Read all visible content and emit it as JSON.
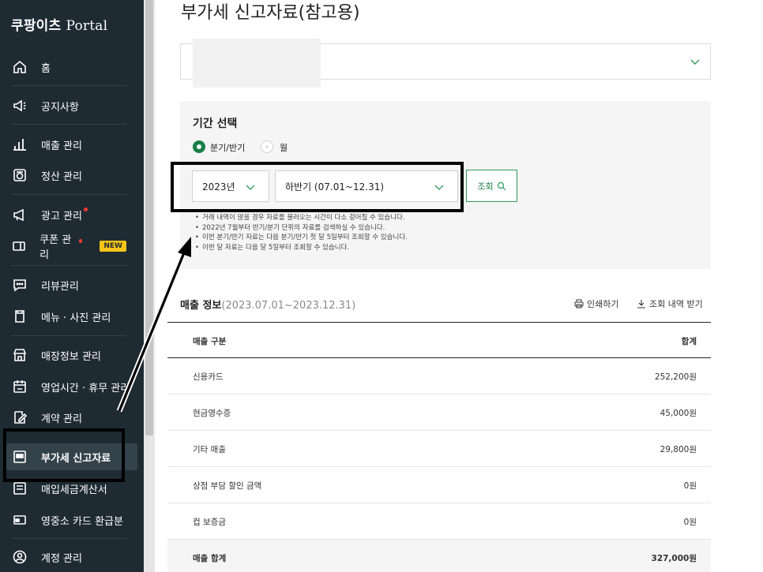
{
  "brand": {
    "ko": "쿠팡이츠",
    "en": "Portal"
  },
  "sidebar": {
    "items": [
      {
        "label": "홈",
        "icon": "home-icon"
      },
      {
        "label": "공지사항",
        "icon": "megaphone-icon"
      },
      {
        "label": "매출 관리",
        "icon": "bar-chart-icon"
      },
      {
        "label": "정산 관리",
        "icon": "settlement-icon"
      },
      {
        "label": "광고 관리",
        "icon": "ad-megaphone-icon"
      },
      {
        "label": "쿠폰 관리",
        "icon": "coupon-icon",
        "badge": "NEW"
      },
      {
        "label": "리뷰관리",
        "icon": "review-icon"
      },
      {
        "label": "메뉴 · 사진 관리",
        "icon": "menu-photo-icon"
      },
      {
        "label": "매장정보 관리",
        "icon": "store-icon"
      },
      {
        "label": "영업시간 · 휴무 관리",
        "icon": "calendar-icon"
      },
      {
        "label": "계약 관리",
        "icon": "contract-icon"
      },
      {
        "label": "부가세 신고자료",
        "icon": "vat-icon",
        "active": true
      },
      {
        "label": "매입세금계산서",
        "icon": "tax-invoice-icon"
      },
      {
        "label": "영중소 카드 환급분",
        "icon": "card-icon"
      },
      {
        "label": "계정 관리",
        "icon": "account-icon"
      }
    ]
  },
  "page": {
    "title": "부가세 신고자료(참고용)"
  },
  "period": {
    "title": "기간 선택",
    "options": [
      "분기/반기",
      "월"
    ],
    "year": "2023년",
    "half": "하반기 (07.01~12.31)",
    "query_label": "조회",
    "notes": [
      "거래 내역이 많을 경우 자료를 불러오는 시간이 다소 걸어질 수 있습니다.",
      "2022년 7월부터 반기/분기 단위의 자료를 검색하실 수 있습니다.",
      "이번 분기/반기 자료는 다음 분기/반기 첫 달 5일부터 조회할 수 있습니다.",
      "이번 달 자료는 다음 달 5일부터 조회할 수 있습니다."
    ]
  },
  "sales": {
    "title": "매출 정보",
    "range": "(2023.07.01~2023.12.31)",
    "print_label": "인쇄하기",
    "download_label": "조회 내역 받기",
    "header": {
      "category": "매출 구분",
      "total": "합계"
    },
    "rows": [
      {
        "label": "신용카드",
        "value": "252,200원"
      },
      {
        "label": "현금영수증",
        "value": "45,000원"
      },
      {
        "label": "기타 매출",
        "value": "29,800원"
      },
      {
        "label": "상점 부담 할인 금액",
        "value": "0원"
      },
      {
        "label": "컵 보증금",
        "value": "0원"
      }
    ],
    "total_row": {
      "label": "매출 합계",
      "value": "327,000원"
    }
  }
}
